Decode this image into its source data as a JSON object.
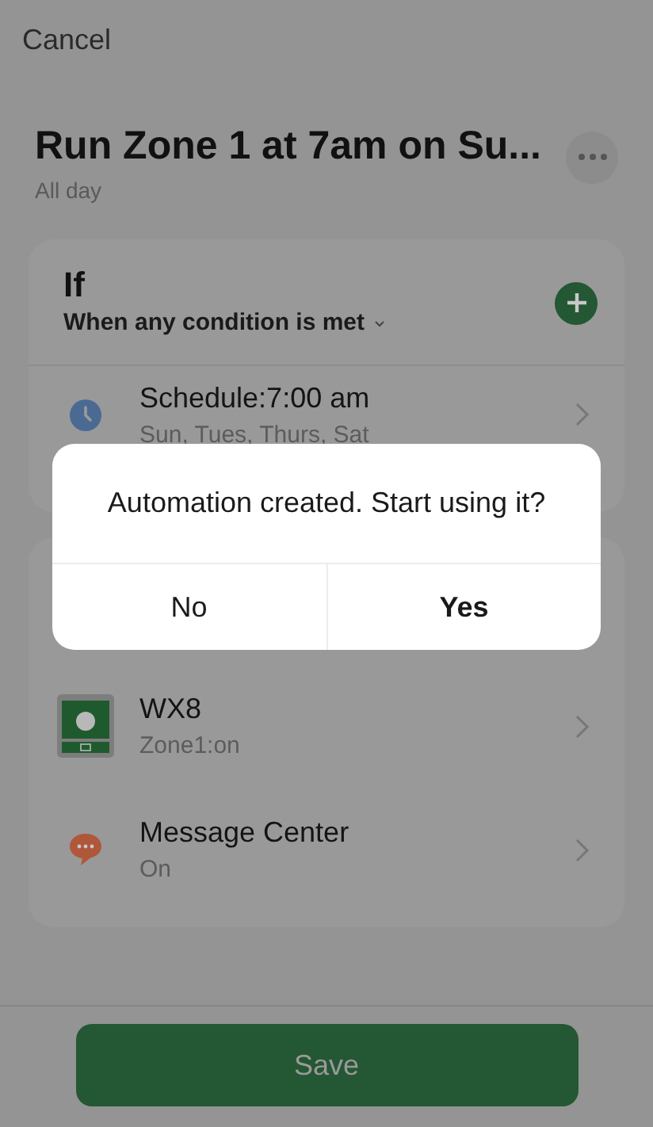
{
  "header": {
    "cancel": "Cancel",
    "title": "Run Zone 1 at 7am on Su...",
    "subtitle": "All day"
  },
  "if_card": {
    "title": "If",
    "condition": "When any condition is met",
    "conditions": [
      {
        "kind": "schedule",
        "title": "Schedule:7:00 am",
        "detail": "Sun, Tues, Thurs, Sat"
      }
    ]
  },
  "then_card": {
    "actions": [
      {
        "kind": "device",
        "title": "WX8",
        "detail": "Zone1:on"
      },
      {
        "kind": "message",
        "title": "Message Center",
        "detail": "On"
      }
    ]
  },
  "save_button": "Save",
  "dialog": {
    "message": "Automation created. Start using it?",
    "buttons": [
      {
        "label": "No",
        "kind": "cancel"
      },
      {
        "label": "Yes",
        "kind": "confirm"
      }
    ]
  }
}
